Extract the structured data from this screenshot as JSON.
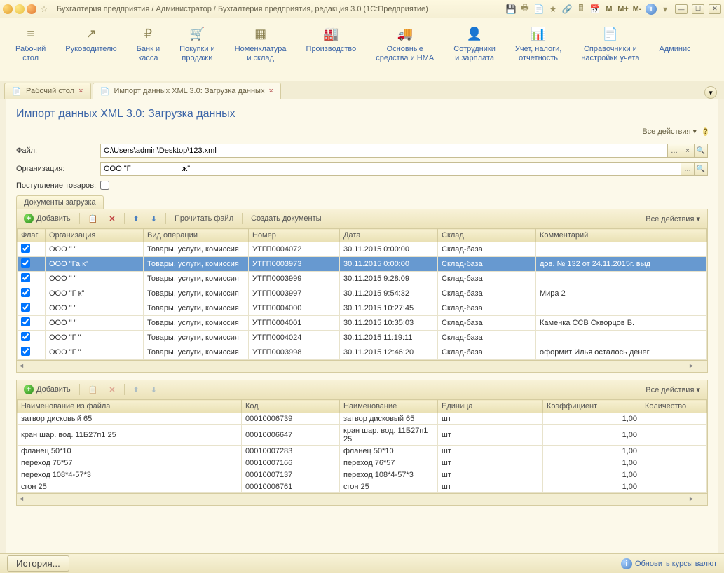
{
  "titlebar": {
    "text": "Бухгалтерия предприятия / Администратор / Бухгалтерия предприятия, редакция 3.0  (1С:Предприятие)",
    "m1": "M",
    "m2": "M+",
    "m3": "M-"
  },
  "topmenu": [
    {
      "icon": "≡",
      "label": "Рабочий\nстол"
    },
    {
      "icon": "↗",
      "label": "Руководителю"
    },
    {
      "icon": "₽",
      "label": "Банк и\nкасса"
    },
    {
      "icon": "🛒",
      "label": "Покупки и\nпродажи"
    },
    {
      "icon": "▦",
      "label": "Номенклатура\nи склад"
    },
    {
      "icon": "🏭",
      "label": "Производство"
    },
    {
      "icon": "🚚",
      "label": "Основные\nсредства и НМА"
    },
    {
      "icon": "👤",
      "label": "Сотрудники\nи зарплата"
    },
    {
      "icon": "📊",
      "label": "Учет, налоги,\nотчетность"
    },
    {
      "icon": "📄",
      "label": "Справочники и\nнастройки учета"
    },
    {
      "icon": "",
      "label": "Админис"
    }
  ],
  "tabs": [
    {
      "label": "Рабочий стол"
    },
    {
      "label": "Импорт данных XML 3.0: Загрузка данных",
      "active": true
    }
  ],
  "page": {
    "title": "Импорт данных XML 3.0: Загрузка данных",
    "all_actions": "Все действия ▾"
  },
  "fields": {
    "file_lbl": "Файл:",
    "file_val": "C:\\Users\\admin\\Desktop\\123.xml",
    "org_lbl": "Организация:",
    "org_val": "ООО \"Г                        ж\"",
    "receipt_lbl": "Поступление товаров:"
  },
  "subtab": "Документы загрузка",
  "toolbar1": {
    "add": "Добавить",
    "readfile": "Прочитать файл",
    "createdocs": "Создать документы",
    "all_actions": "Все действия ▾"
  },
  "table1": {
    "cols": [
      "Флаг",
      "Организация",
      "Вид операции",
      "Номер",
      "Дата",
      "Склад",
      "Комментарий"
    ],
    "rows": [
      {
        "org": "ООО \"                       \"",
        "op": "Товары, услуги, комиссия",
        "num": "УТГП0004072",
        "date": "30.11.2015 0:00:00",
        "wh": "Склад-база",
        "cm": ""
      },
      {
        "org": "ООО \"Га                   к\"",
        "op": "Товары, услуги, комиссия",
        "num": "УТГП0003973",
        "date": "30.11.2015 0:00:00",
        "wh": "Склад-база",
        "cm": "дов. № 132 от 24.11.2015г.   выд",
        "sel": true
      },
      {
        "org": "ООО \"                      \"",
        "op": "Товары, услуги, комиссия",
        "num": "УТГП0003999",
        "date": "30.11.2015 9:28:09",
        "wh": "Склад-база",
        "cm": ""
      },
      {
        "org": "ООО \"Г                    к\"",
        "op": "Товары, услуги, комиссия",
        "num": "УТГП0003997",
        "date": "30.11.2015 9:54:32",
        "wh": "Склад-база",
        "cm": "Мира 2"
      },
      {
        "org": "ООО \"                       \"",
        "op": "Товары, услуги, комиссия",
        "num": "УТГП0004000",
        "date": "30.11.2015 10:27:45",
        "wh": "Склад-база",
        "cm": ""
      },
      {
        "org": "ООО \"                       \"",
        "op": "Товары, услуги, комиссия",
        "num": "УТГП0004001",
        "date": "30.11.2015 10:35:03",
        "wh": "Склад-база",
        "cm": "Каменка ССВ   Скворцов В."
      },
      {
        "org": "ООО \"Г                      \"",
        "op": "Товары, услуги, комиссия",
        "num": "УТГП0004024",
        "date": "30.11.2015 11:19:11",
        "wh": "Склад-база",
        "cm": ""
      },
      {
        "org": "ООО \"Г                      \"",
        "op": "Товары, услуги, комиссия",
        "num": "УТГП0003998",
        "date": "30.11.2015 12:46:20",
        "wh": "Склад-база",
        "cm": "оформит Илья  осталось денег"
      }
    ]
  },
  "toolbar2": {
    "add": "Добавить",
    "all_actions": "Все действия ▾"
  },
  "table2": {
    "cols": [
      "Наименование из файла",
      "Код",
      "Наименование",
      "Единица",
      "Коэффициент",
      "Количество"
    ],
    "rows": [
      {
        "name": "затвор дисковый 65",
        "code": "00010006739",
        "n2": "затвор дисковый 65",
        "u": "шт",
        "k": "1,00",
        "q": ""
      },
      {
        "name": "кран шар. вод. 11Б27п1 25",
        "code": "00010006647",
        "n2": "кран шар. вод. 11Б27п1 25",
        "u": "шт",
        "k": "1,00",
        "q": ""
      },
      {
        "name": "фланец 50*10",
        "code": "00010007283",
        "n2": "фланец 50*10",
        "u": "шт",
        "k": "1,00",
        "q": ""
      },
      {
        "name": "переход 76*57",
        "code": "00010007166",
        "n2": "переход 76*57",
        "u": "шт",
        "k": "1,00",
        "q": ""
      },
      {
        "name": "переход 108*4-57*3",
        "code": "00010007137",
        "n2": "переход 108*4-57*3",
        "u": "шт",
        "k": "1,00",
        "q": ""
      },
      {
        "name": "сгон 25",
        "code": "00010006761",
        "n2": "сгон 25",
        "u": "шт",
        "k": "1,00",
        "q": ""
      }
    ]
  },
  "status": {
    "history": "История...",
    "update": "Обновить курсы валют"
  }
}
